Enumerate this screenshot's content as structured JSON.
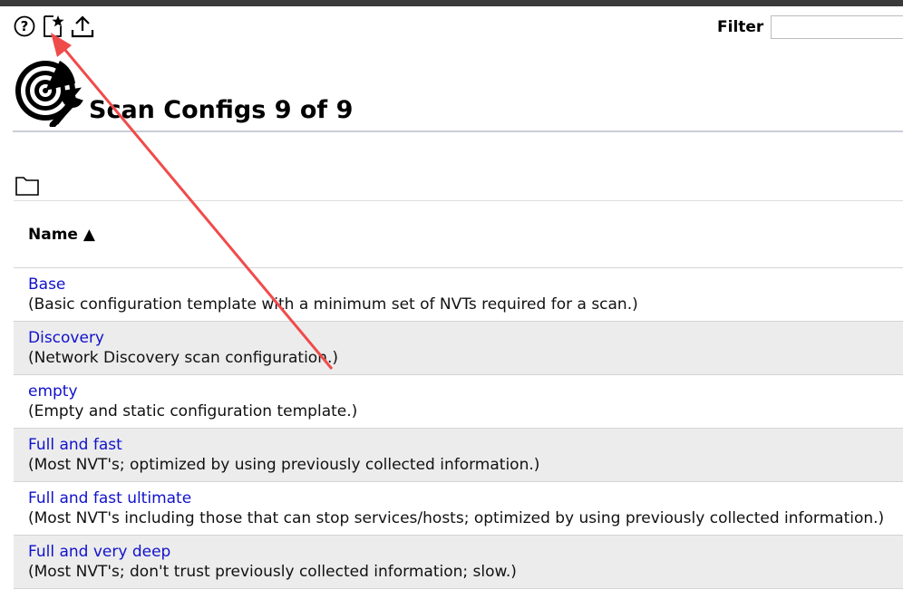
{
  "toolbar": {
    "items": [
      {
        "icon": "help-icon"
      },
      {
        "icon": "new-scan-config-icon"
      },
      {
        "icon": "upload-icon"
      }
    ]
  },
  "filter": {
    "label": "Filter",
    "value": ""
  },
  "page": {
    "title": "Scan Configs 9 of 9",
    "logo_icon": "scan-config-radar-wrench-icon"
  },
  "folder_icon": "folder-icon",
  "table": {
    "column_name": "Name ▲",
    "rows": [
      {
        "name": "Base",
        "description": "(Basic configuration template with a minimum set of NVTs required for a scan.)"
      },
      {
        "name": "Discovery",
        "description": "(Network Discovery scan configuration.)"
      },
      {
        "name": "empty",
        "description": "(Empty and static configuration template.)"
      },
      {
        "name": "Full and fast",
        "description": "(Most NVT's; optimized by using previously collected information.)"
      },
      {
        "name": "Full and fast ultimate",
        "description": "(Most NVT's including those that can stop services/hosts; optimized by using previously collected information.)"
      },
      {
        "name": "Full and very deep",
        "description": "(Most NVT's; don't trust previously collected information; slow.)"
      }
    ]
  },
  "colors": {
    "link": "#1111cc",
    "row_alt": "#ececec",
    "annotation_arrow": "#f04b4b"
  }
}
